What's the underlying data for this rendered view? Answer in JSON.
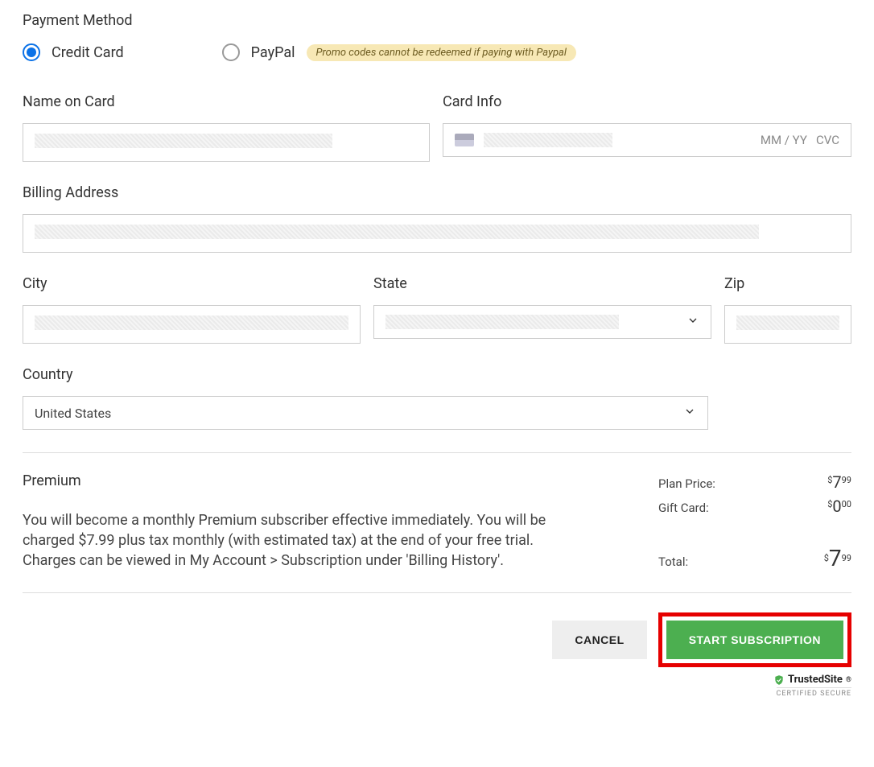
{
  "payment_method": {
    "title": "Payment Method",
    "options": {
      "credit_card": "Credit Card",
      "paypal": "PayPal"
    },
    "promo_note": "Promo codes cannot be redeemed if paying with Paypal"
  },
  "fields": {
    "name_on_card": "Name on Card",
    "card_info": "Card Info",
    "card_expiry": "MM / YY",
    "card_cvc": "CVC",
    "billing_address": "Billing Address",
    "city": "City",
    "state": "State",
    "zip": "Zip",
    "country": "Country",
    "country_value": "United States"
  },
  "summary": {
    "plan_name": "Premium",
    "description": "You will become a monthly Premium subscriber effective immediately. You will be charged $7.99 plus tax monthly (with estimated tax) at the end of your free trial. Charges can be viewed in My Account > Subscription under 'Billing History'.",
    "rows": {
      "plan_price_label": "Plan Price:",
      "plan_price_whole": "7",
      "plan_price_cents": "99",
      "gift_card_label": "Gift Card:",
      "gift_card_whole": "0",
      "gift_card_cents": "00",
      "total_label": "Total:",
      "total_whole": "7",
      "total_cents": "99",
      "currency": "$"
    }
  },
  "actions": {
    "cancel": "CANCEL",
    "start": "START SUBSCRIPTION"
  },
  "trusted": {
    "name": "TrustedSite",
    "sub": "CERTIFIED SECURE"
  }
}
